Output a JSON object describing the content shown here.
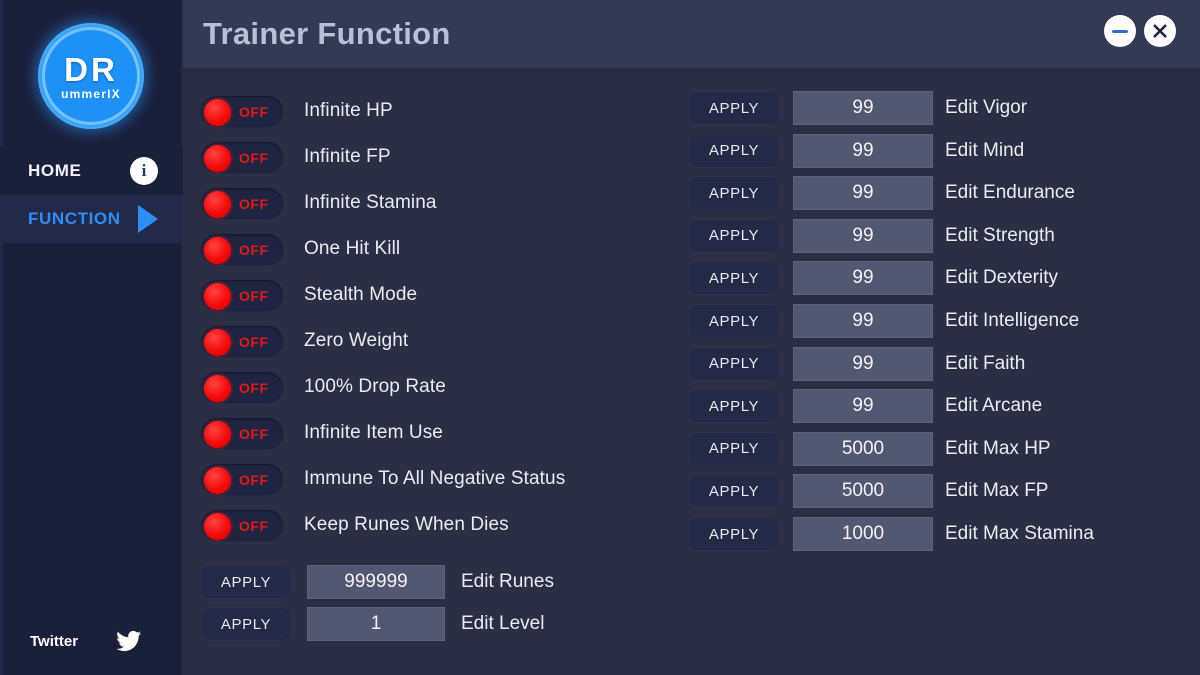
{
  "window": {
    "title": "Trainer Function",
    "minimize_label": "minimize",
    "close_label": "close"
  },
  "sidebar": {
    "logo": {
      "main": "DR",
      "sub": "ummerIX"
    },
    "nav": [
      {
        "label": "HOME",
        "icon": "info-icon",
        "active": false
      },
      {
        "label": "FUNCTION",
        "icon": "play-icon",
        "active": true
      }
    ],
    "footer": {
      "label": "Twitter",
      "icon": "twitter-icon"
    }
  },
  "main": {
    "apply_label": "APPLY",
    "toggles": [
      {
        "label": "Infinite HP",
        "state": "OFF"
      },
      {
        "label": "Infinite FP",
        "state": "OFF"
      },
      {
        "label": "Infinite Stamina",
        "state": "OFF"
      },
      {
        "label": "One Hit Kill",
        "state": "OFF"
      },
      {
        "label": "Stealth Mode",
        "state": "OFF"
      },
      {
        "label": "Zero Weight",
        "state": "OFF"
      },
      {
        "label": "100% Drop Rate",
        "state": "OFF"
      },
      {
        "label": "Infinite Item Use",
        "state": "OFF"
      },
      {
        "label": "Immune To All Negative Status",
        "state": "OFF"
      },
      {
        "label": "Keep Runes When Dies",
        "state": "OFF"
      }
    ],
    "left_fields": [
      {
        "apply": "APPLY",
        "value": "999999",
        "label": "Edit Runes"
      },
      {
        "apply": "APPLY",
        "value": "1",
        "label": "Edit Level"
      }
    ],
    "right_fields": [
      {
        "apply": "APPLY",
        "value": "99",
        "label": "Edit Vigor"
      },
      {
        "apply": "APPLY",
        "value": "99",
        "label": "Edit Mind"
      },
      {
        "apply": "APPLY",
        "value": "99",
        "label": "Edit Endurance"
      },
      {
        "apply": "APPLY",
        "value": "99",
        "label": "Edit Strength"
      },
      {
        "apply": "APPLY",
        "value": "99",
        "label": "Edit Dexterity"
      },
      {
        "apply": "APPLY",
        "value": "99",
        "label": "Edit Intelligence"
      },
      {
        "apply": "APPLY",
        "value": "99",
        "label": "Edit Faith"
      },
      {
        "apply": "APPLY",
        "value": "99",
        "label": "Edit Arcane"
      },
      {
        "apply": "APPLY",
        "value": "5000",
        "label": "Edit Max HP"
      },
      {
        "apply": "APPLY",
        "value": "5000",
        "label": "Edit Max FP"
      },
      {
        "apply": "APPLY",
        "value": "1000",
        "label": "Edit Max Stamina"
      }
    ]
  },
  "colors": {
    "background": "#2b2f44",
    "sidebar": "#1a1f3a",
    "header": "#343a53",
    "accent_blue": "#2a8cf5",
    "toggle_red": "#e01a1a",
    "field_gray": "#525870"
  }
}
